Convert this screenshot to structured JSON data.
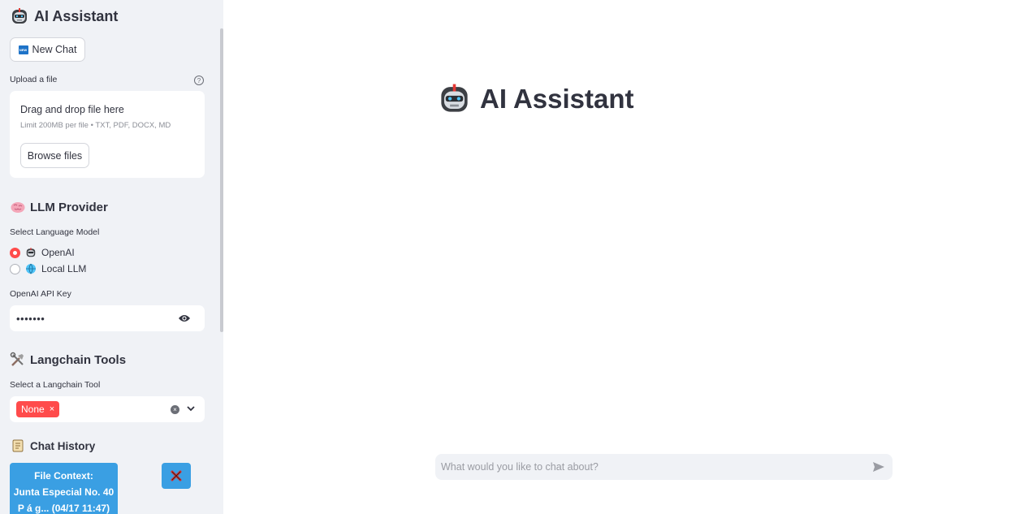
{
  "sidebar": {
    "title": "AI Assistant",
    "new_chat_label": "New Chat",
    "new_chat_badge": "NEW",
    "upload": {
      "label": "Upload a file",
      "help": "?",
      "drop_title": "Drag and drop file here",
      "drop_sub": "Limit 200MB per file • TXT, PDF, DOCX, MD",
      "browse_label": "Browse files"
    },
    "llm": {
      "heading": "LLM Provider",
      "select_label": "Select Language Model",
      "options": [
        {
          "label": "OpenAI",
          "selected": true,
          "icon": "robot-icon"
        },
        {
          "label": "Local LLM",
          "selected": false,
          "icon": "globe-icon"
        }
      ],
      "api_key_label": "OpenAI API Key",
      "api_key_value": "•••••••"
    },
    "tools": {
      "heading": "Langchain Tools",
      "select_label": "Select a Langchain Tool",
      "selected_chip": "None",
      "chip_remove": "×"
    },
    "history": {
      "heading": "Chat History",
      "items": [
        {
          "line1": "File Context:",
          "line2": "Junta Especial No. 40",
          "line3": "P á g... (04/17 11:47)"
        }
      ]
    }
  },
  "main": {
    "title": "AI Assistant",
    "chat_placeholder": "What would you like to chat about?"
  },
  "colors": {
    "accent": "#ff4b4b",
    "history_button": "#3a9fe3",
    "sidebar_bg": "#f0f2f6"
  }
}
